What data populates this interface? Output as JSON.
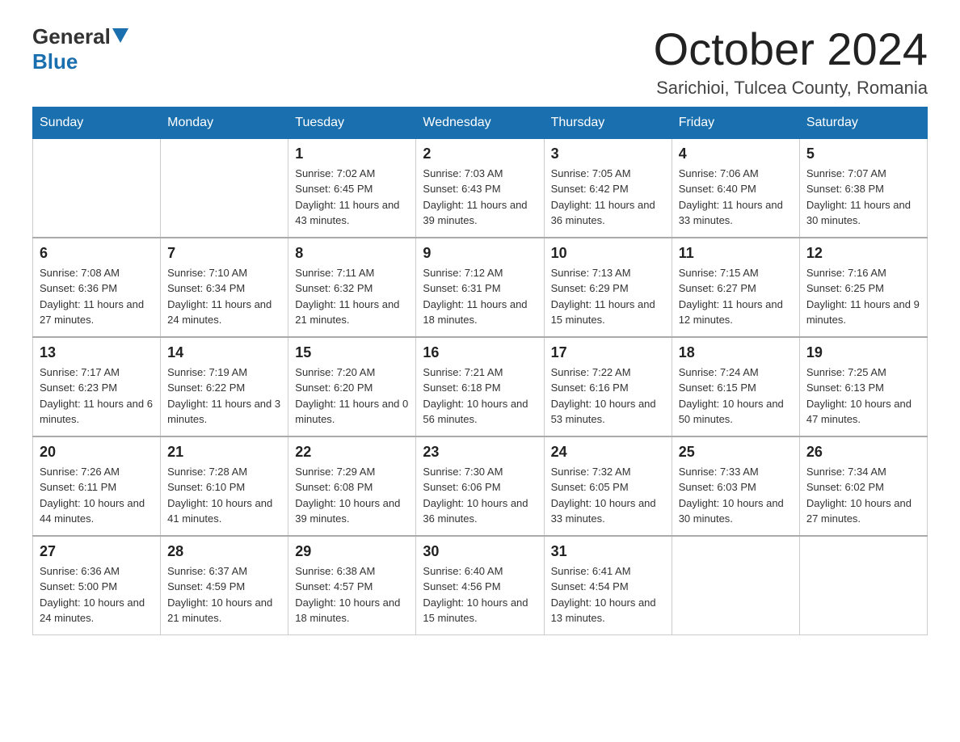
{
  "header": {
    "logo_general": "General",
    "logo_blue": "Blue",
    "month_title": "October 2024",
    "location": "Sarichioi, Tulcea County, Romania"
  },
  "calendar": {
    "days_of_week": [
      "Sunday",
      "Monday",
      "Tuesday",
      "Wednesday",
      "Thursday",
      "Friday",
      "Saturday"
    ],
    "weeks": [
      [
        {
          "day": "",
          "sunrise": "",
          "sunset": "",
          "daylight": ""
        },
        {
          "day": "",
          "sunrise": "",
          "sunset": "",
          "daylight": ""
        },
        {
          "day": "1",
          "sunrise": "Sunrise: 7:02 AM",
          "sunset": "Sunset: 6:45 PM",
          "daylight": "Daylight: 11 hours and 43 minutes."
        },
        {
          "day": "2",
          "sunrise": "Sunrise: 7:03 AM",
          "sunset": "Sunset: 6:43 PM",
          "daylight": "Daylight: 11 hours and 39 minutes."
        },
        {
          "day": "3",
          "sunrise": "Sunrise: 7:05 AM",
          "sunset": "Sunset: 6:42 PM",
          "daylight": "Daylight: 11 hours and 36 minutes."
        },
        {
          "day": "4",
          "sunrise": "Sunrise: 7:06 AM",
          "sunset": "Sunset: 6:40 PM",
          "daylight": "Daylight: 11 hours and 33 minutes."
        },
        {
          "day": "5",
          "sunrise": "Sunrise: 7:07 AM",
          "sunset": "Sunset: 6:38 PM",
          "daylight": "Daylight: 11 hours and 30 minutes."
        }
      ],
      [
        {
          "day": "6",
          "sunrise": "Sunrise: 7:08 AM",
          "sunset": "Sunset: 6:36 PM",
          "daylight": "Daylight: 11 hours and 27 minutes."
        },
        {
          "day": "7",
          "sunrise": "Sunrise: 7:10 AM",
          "sunset": "Sunset: 6:34 PM",
          "daylight": "Daylight: 11 hours and 24 minutes."
        },
        {
          "day": "8",
          "sunrise": "Sunrise: 7:11 AM",
          "sunset": "Sunset: 6:32 PM",
          "daylight": "Daylight: 11 hours and 21 minutes."
        },
        {
          "day": "9",
          "sunrise": "Sunrise: 7:12 AM",
          "sunset": "Sunset: 6:31 PM",
          "daylight": "Daylight: 11 hours and 18 minutes."
        },
        {
          "day": "10",
          "sunrise": "Sunrise: 7:13 AM",
          "sunset": "Sunset: 6:29 PM",
          "daylight": "Daylight: 11 hours and 15 minutes."
        },
        {
          "day": "11",
          "sunrise": "Sunrise: 7:15 AM",
          "sunset": "Sunset: 6:27 PM",
          "daylight": "Daylight: 11 hours and 12 minutes."
        },
        {
          "day": "12",
          "sunrise": "Sunrise: 7:16 AM",
          "sunset": "Sunset: 6:25 PM",
          "daylight": "Daylight: 11 hours and 9 minutes."
        }
      ],
      [
        {
          "day": "13",
          "sunrise": "Sunrise: 7:17 AM",
          "sunset": "Sunset: 6:23 PM",
          "daylight": "Daylight: 11 hours and 6 minutes."
        },
        {
          "day": "14",
          "sunrise": "Sunrise: 7:19 AM",
          "sunset": "Sunset: 6:22 PM",
          "daylight": "Daylight: 11 hours and 3 minutes."
        },
        {
          "day": "15",
          "sunrise": "Sunrise: 7:20 AM",
          "sunset": "Sunset: 6:20 PM",
          "daylight": "Daylight: 11 hours and 0 minutes."
        },
        {
          "day": "16",
          "sunrise": "Sunrise: 7:21 AM",
          "sunset": "Sunset: 6:18 PM",
          "daylight": "Daylight: 10 hours and 56 minutes."
        },
        {
          "day": "17",
          "sunrise": "Sunrise: 7:22 AM",
          "sunset": "Sunset: 6:16 PM",
          "daylight": "Daylight: 10 hours and 53 minutes."
        },
        {
          "day": "18",
          "sunrise": "Sunrise: 7:24 AM",
          "sunset": "Sunset: 6:15 PM",
          "daylight": "Daylight: 10 hours and 50 minutes."
        },
        {
          "day": "19",
          "sunrise": "Sunrise: 7:25 AM",
          "sunset": "Sunset: 6:13 PM",
          "daylight": "Daylight: 10 hours and 47 minutes."
        }
      ],
      [
        {
          "day": "20",
          "sunrise": "Sunrise: 7:26 AM",
          "sunset": "Sunset: 6:11 PM",
          "daylight": "Daylight: 10 hours and 44 minutes."
        },
        {
          "day": "21",
          "sunrise": "Sunrise: 7:28 AM",
          "sunset": "Sunset: 6:10 PM",
          "daylight": "Daylight: 10 hours and 41 minutes."
        },
        {
          "day": "22",
          "sunrise": "Sunrise: 7:29 AM",
          "sunset": "Sunset: 6:08 PM",
          "daylight": "Daylight: 10 hours and 39 minutes."
        },
        {
          "day": "23",
          "sunrise": "Sunrise: 7:30 AM",
          "sunset": "Sunset: 6:06 PM",
          "daylight": "Daylight: 10 hours and 36 minutes."
        },
        {
          "day": "24",
          "sunrise": "Sunrise: 7:32 AM",
          "sunset": "Sunset: 6:05 PM",
          "daylight": "Daylight: 10 hours and 33 minutes."
        },
        {
          "day": "25",
          "sunrise": "Sunrise: 7:33 AM",
          "sunset": "Sunset: 6:03 PM",
          "daylight": "Daylight: 10 hours and 30 minutes."
        },
        {
          "day": "26",
          "sunrise": "Sunrise: 7:34 AM",
          "sunset": "Sunset: 6:02 PM",
          "daylight": "Daylight: 10 hours and 27 minutes."
        }
      ],
      [
        {
          "day": "27",
          "sunrise": "Sunrise: 6:36 AM",
          "sunset": "Sunset: 5:00 PM",
          "daylight": "Daylight: 10 hours and 24 minutes."
        },
        {
          "day": "28",
          "sunrise": "Sunrise: 6:37 AM",
          "sunset": "Sunset: 4:59 PM",
          "daylight": "Daylight: 10 hours and 21 minutes."
        },
        {
          "day": "29",
          "sunrise": "Sunrise: 6:38 AM",
          "sunset": "Sunset: 4:57 PM",
          "daylight": "Daylight: 10 hours and 18 minutes."
        },
        {
          "day": "30",
          "sunrise": "Sunrise: 6:40 AM",
          "sunset": "Sunset: 4:56 PM",
          "daylight": "Daylight: 10 hours and 15 minutes."
        },
        {
          "day": "31",
          "sunrise": "Sunrise: 6:41 AM",
          "sunset": "Sunset: 4:54 PM",
          "daylight": "Daylight: 10 hours and 13 minutes."
        },
        {
          "day": "",
          "sunrise": "",
          "sunset": "",
          "daylight": ""
        },
        {
          "day": "",
          "sunrise": "",
          "sunset": "",
          "daylight": ""
        }
      ]
    ]
  }
}
